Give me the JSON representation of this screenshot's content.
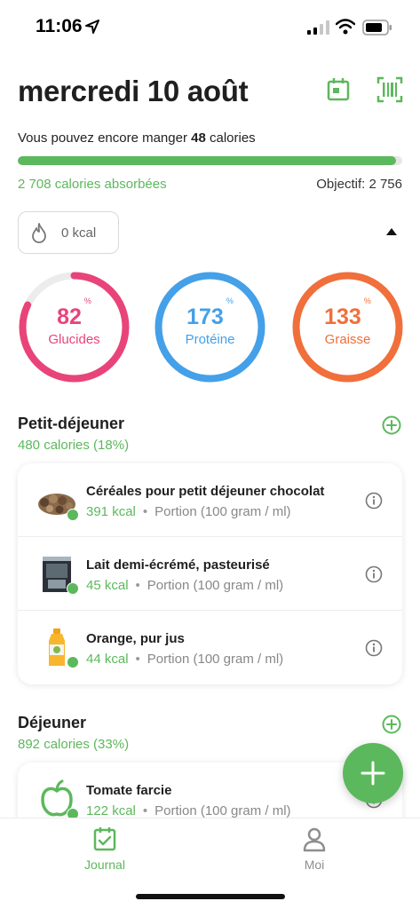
{
  "status_bar": {
    "time": "11:06"
  },
  "header": {
    "date": "mercredi 10 août",
    "remaining_prefix": "Vous pouvez encore manger ",
    "remaining_value": "48",
    "remaining_suffix": " calories",
    "progress_fraction": 0.983,
    "absorbed": "2 708 calories absorbées",
    "objective": "Objectif: 2 756",
    "burn": "0 kcal"
  },
  "macros": [
    {
      "value": "82",
      "unit": "%",
      "label": "Glucides",
      "color": "#e8447a",
      "fraction": 0.82
    },
    {
      "value": "173",
      "unit": "%",
      "label": "Protéine",
      "color": "#44a0e8",
      "fraction": 1.0
    },
    {
      "value": "133",
      "unit": "%",
      "label": "Graisse",
      "color": "#f06f3b",
      "fraction": 1.0
    }
  ],
  "meals": [
    {
      "title": "Petit-déjeuner",
      "subtitle": "480 calories (18%)",
      "items": [
        {
          "name": "Céréales pour petit déjeuner chocolat",
          "kcal": "391 kcal",
          "portion": "Portion (100 gram / ml)",
          "thumb": "cereal-thumbnail"
        },
        {
          "name": "Lait demi-écrémé, pasteurisé",
          "kcal": "45 kcal",
          "portion": "Portion (100 gram / ml)",
          "thumb": "milk-thumbnail"
        },
        {
          "name": "Orange, pur jus",
          "kcal": "44 kcal",
          "portion": "Portion (100 gram / ml)",
          "thumb": "juice-thumbnail"
        }
      ]
    },
    {
      "title": "Déjeuner",
      "subtitle": "892 calories (33%)",
      "items": [
        {
          "name": "Tomate farcie",
          "kcal": "122 kcal",
          "portion": "Portion (100 gram / ml)",
          "thumb": "apple-icon"
        }
      ]
    }
  ],
  "nav": {
    "journal": "Journal",
    "me": "Moi"
  },
  "colors": {
    "accent": "#5cb85c"
  },
  "icons": [
    "location-arrow-icon",
    "signal-icon",
    "wifi-icon",
    "battery-icon",
    "calendar-icon",
    "barcode-icon",
    "flame-icon",
    "collapse-arrow-icon",
    "add-icon",
    "info-icon",
    "plus-icon",
    "journal-icon",
    "profile-icon"
  ]
}
